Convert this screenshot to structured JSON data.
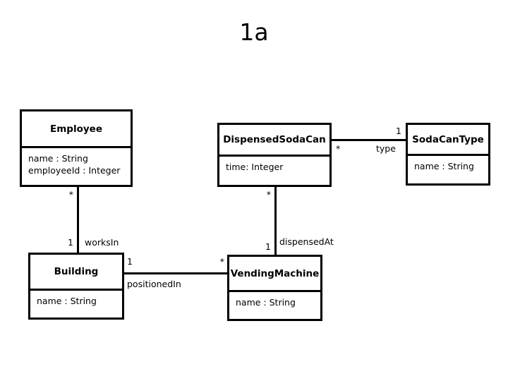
{
  "diagram": {
    "title": "1a",
    "type": "uml-class-diagram"
  },
  "classes": {
    "employee": {
      "name": "Employee",
      "attributes": [
        "name : String",
        "employeeId : Integer"
      ]
    },
    "dispensed_soda_can": {
      "name": "DispensedSodaCan",
      "attributes": [
        "time: Integer"
      ]
    },
    "soda_can_type": {
      "name": "SodaCanType",
      "attributes": [
        "name : String"
      ]
    },
    "building": {
      "name": "Building",
      "attributes": [
        "name : String"
      ]
    },
    "vending_machine": {
      "name": "VendingMachine",
      "attributes": [
        "name : String"
      ]
    }
  },
  "associations": {
    "works_in": {
      "label": "worksIn",
      "source_multiplicity": "*",
      "target_multiplicity": "1"
    },
    "dispensed_at": {
      "label": "dispensedAt",
      "source_multiplicity": "*",
      "target_multiplicity": "1"
    },
    "positioned_in": {
      "label": "positionedIn",
      "source_multiplicity": "1",
      "target_multiplicity": "*"
    },
    "type": {
      "label": "type",
      "source_multiplicity": "*",
      "target_multiplicity": "1"
    }
  },
  "colors": {
    "background": "#ffffff",
    "stroke": "#000000",
    "text": "#000000"
  }
}
